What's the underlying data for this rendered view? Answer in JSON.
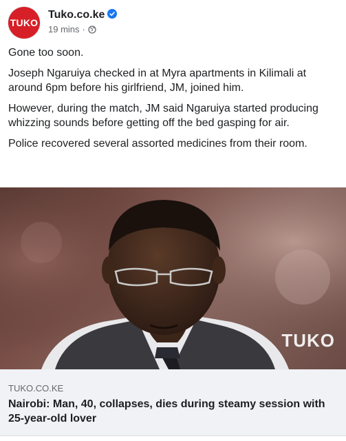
{
  "header": {
    "avatar_text": "TUKO",
    "page_name": "Tuko.co.ke",
    "timestamp": "19 mins",
    "separator": "·"
  },
  "post": {
    "paragraphs": [
      "Gone too soon.",
      "Joseph Ngaruiya checked in at Myra apartments in Kilimali at around 6pm before his girlfriend, JM, joined him.",
      "However, during the match, JM said Ngaruiya started producing whizzing sounds before getting off the bed gasping for air.",
      "Police recovered several assorted medicines from their room."
    ]
  },
  "photo": {
    "watermark": "TUKO"
  },
  "link": {
    "domain": "TUKO.CO.KE",
    "title": "Nairobi: Man, 40, collapses, dies during steamy session with 25-year-old lover"
  },
  "colors": {
    "brand_red": "#d61f26",
    "verified_blue": "#1877f2",
    "link_bg": "#f0f2f5"
  },
  "icons": [
    "verified-badge-icon",
    "globe-icon"
  ]
}
